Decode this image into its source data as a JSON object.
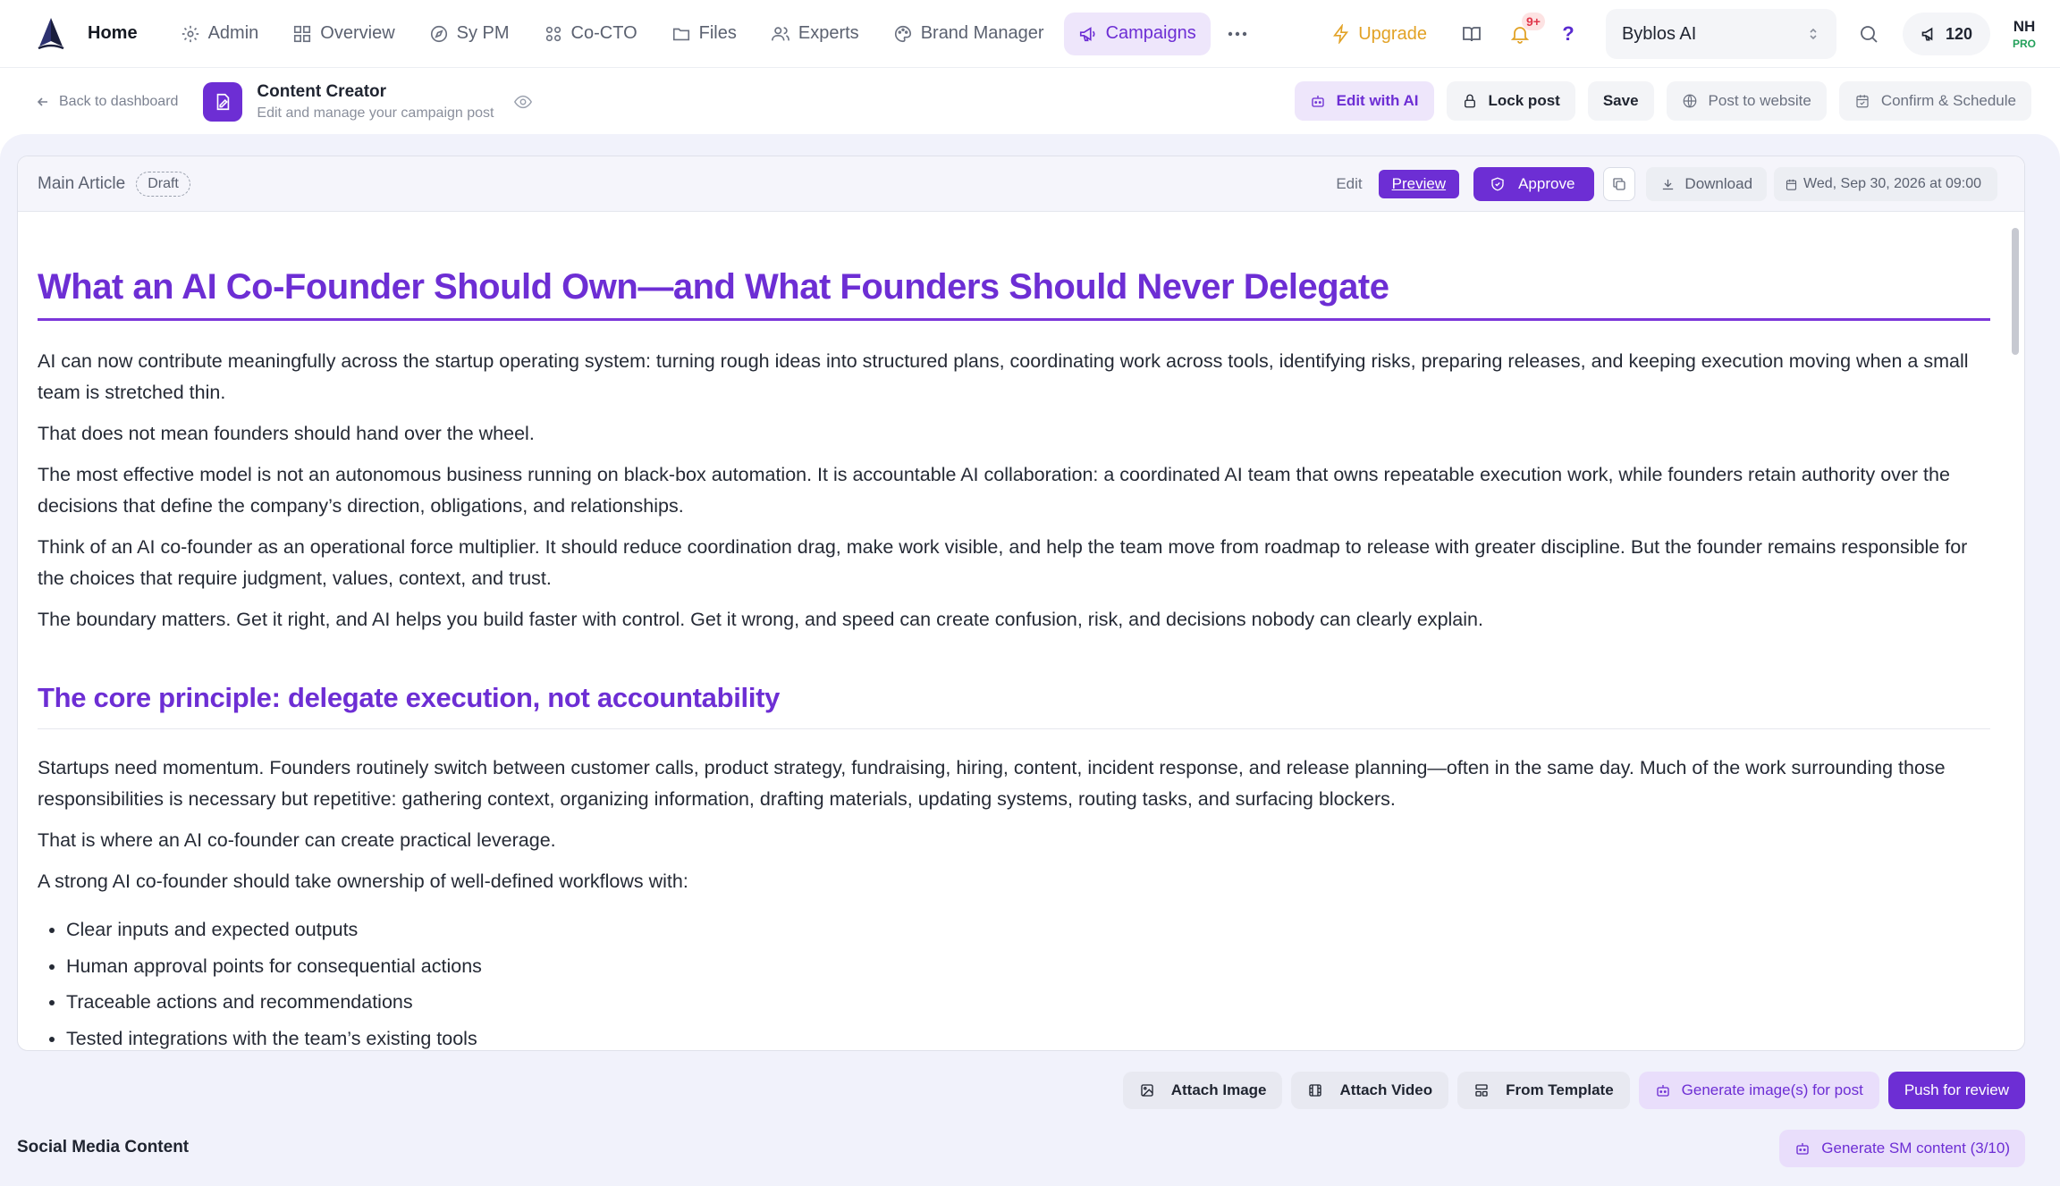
{
  "nav": {
    "home": "Home",
    "items": [
      {
        "label": "Admin",
        "icon": "gear-icon"
      },
      {
        "label": "Overview",
        "icon": "grid-icon"
      },
      {
        "label": "Sy PM",
        "icon": "compass-icon"
      },
      {
        "label": "Co-CTO",
        "icon": "network-icon"
      },
      {
        "label": "Files",
        "icon": "folder-icon"
      },
      {
        "label": "Experts",
        "icon": "users-icon"
      },
      {
        "label": "Brand Manager",
        "icon": "palette-icon"
      },
      {
        "label": "Campaigns",
        "icon": "megaphone-icon"
      }
    ],
    "more": "⋯",
    "upgrade": "Upgrade",
    "notifications_badge": "9+",
    "help": "?",
    "workspace": "Byblos AI",
    "credits": "120",
    "avatar_initials": "NH",
    "avatar_plan": "PRO",
    "accent_color": "#6d2ed4"
  },
  "subheader": {
    "back": "Back to dashboard",
    "title": "Content Creator",
    "subtitle": "Edit and manage your campaign post",
    "actions": {
      "edit_ai": "Edit with AI",
      "lock": "Lock post",
      "save": "Save",
      "post_website": "Post to website",
      "confirm_schedule": "Confirm & Schedule"
    }
  },
  "editor": {
    "section_label": "Main Article",
    "status": "Draft",
    "tab_edit": "Edit",
    "tab_preview": "Preview",
    "approve": "Approve",
    "download": "Download",
    "scheduled_date": "Wed, Sep 30, 2026 at 09:00"
  },
  "article": {
    "title": "What an AI Co-Founder Should Own—and What Founders Should Never Delegate",
    "intro": [
      "AI can now contribute meaningfully across the startup operating system: turning rough ideas into structured plans, coordinating work across tools, identifying risks, preparing releases, and keeping execution moving when a small team is stretched thin.",
      "That does not mean founders should hand over the wheel.",
      "The most effective model is not an autonomous business running on black-box automation. It is accountable AI collaboration: a coordinated AI team that owns repeatable execution work, while founders retain authority over the decisions that define the company’s direction, obligations, and relationships.",
      "Think of an AI co-founder as an operational force multiplier. It should reduce coordination drag, make work visible, and help the team move from roadmap to release with greater discipline. But the founder remains responsible for the choices that require judgment, values, context, and trust.",
      "The boundary matters. Get it right, and AI helps you build faster with control. Get it wrong, and speed can create confusion, risk, and decisions nobody can clearly explain."
    ],
    "section_heading": "The core principle: delegate execution, not accountability",
    "section_paragraphs": [
      "Startups need momentum. Founders routinely switch between customer calls, product strategy, fundraising, hiring, content, incident response, and release planning—often in the same day. Much of the work surrounding those responsibilities is necessary but repetitive: gathering context, organizing information, drafting materials, updating systems, routing tasks, and surfacing blockers.",
      "That is where an AI co-founder can create practical leverage.",
      "A strong AI co-founder should take ownership of well-defined workflows with:"
    ],
    "bullets": [
      "Clear inputs and expected outputs",
      "Human approval points for consequential actions",
      "Traceable actions and recommendations",
      "Tested integrations with the team’s existing tools"
    ]
  },
  "bottom": {
    "attach_image": "Attach Image",
    "attach_video": "Attach Video",
    "from_template": "From Template",
    "generate_images": "Generate image(s) for post",
    "push_review": "Push for review",
    "social_label": "Social Media Content",
    "generate_sm": "Generate SM content (3/10)"
  }
}
